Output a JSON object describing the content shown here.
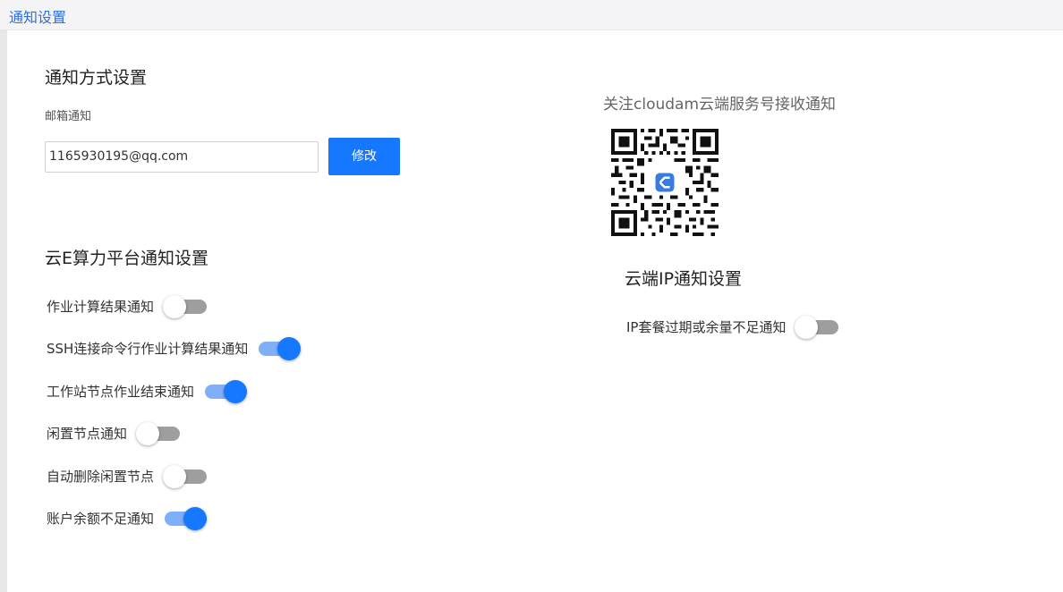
{
  "header": {
    "title": "通知设置"
  },
  "notify_method": {
    "section_title": "通知方式设置",
    "email_label": "邮箱通知",
    "email_value": "1165930195@qq.com",
    "modify_button": "修改"
  },
  "platform": {
    "section_title": "云E算力平台通知设置",
    "toggles": [
      {
        "label": "作业计算结果通知",
        "on": false
      },
      {
        "label": "SSH连接命令行作业计算结果通知",
        "on": true
      },
      {
        "label": "工作站节点作业结束通知",
        "on": true
      },
      {
        "label": "闲置节点通知",
        "on": false
      },
      {
        "label": "自动删除闲置节点",
        "on": false
      },
      {
        "label": "账户余额不足通知",
        "on": true
      }
    ]
  },
  "wechat": {
    "caption": "关注cloudam云端服务号接收通知"
  },
  "cloud_ip": {
    "section_title": "云端IP通知设置",
    "toggles": [
      {
        "label": "IP套餐过期或余量不足通知",
        "on": false
      }
    ]
  },
  "colors": {
    "accent": "#1677ff",
    "title_link": "#2f6fd6",
    "switch_off_track": "#9e9e9e",
    "switch_on_track": "#7fb0f7"
  }
}
